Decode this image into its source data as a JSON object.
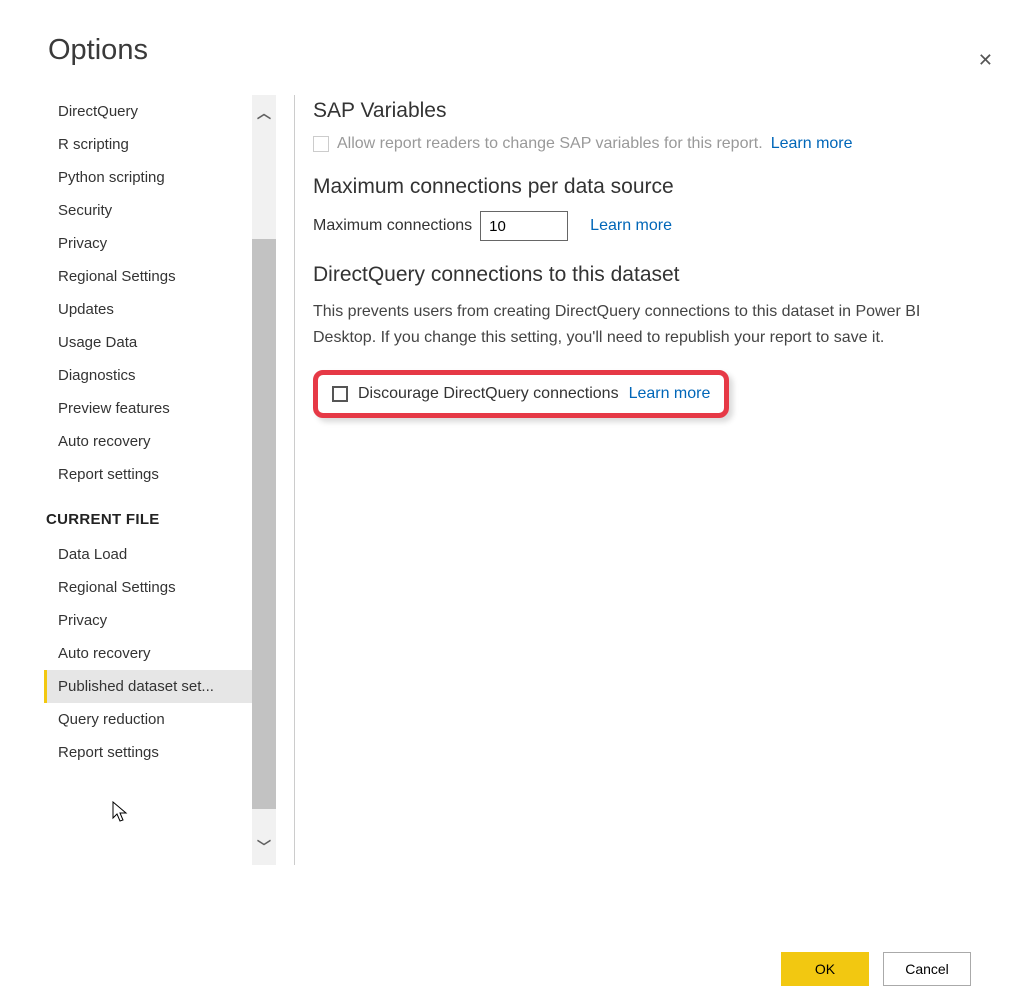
{
  "dialog": {
    "title": "Options",
    "ok_label": "OK",
    "cancel_label": "Cancel"
  },
  "sidebar": {
    "global_items": [
      "DirectQuery",
      "R scripting",
      "Python scripting",
      "Security",
      "Privacy",
      "Regional Settings",
      "Updates",
      "Usage Data",
      "Diagnostics",
      "Preview features",
      "Auto recovery",
      "Report settings"
    ],
    "section_label": "CURRENT FILE",
    "file_items": [
      "Data Load",
      "Regional Settings",
      "Privacy",
      "Auto recovery",
      "Published dataset set...",
      "Query reduction",
      "Report settings"
    ],
    "selected_file_index": 4
  },
  "content": {
    "sap": {
      "heading": "SAP Variables",
      "checkbox_label": "Allow report readers to change SAP variables for this report.",
      "learn_more": "Learn more"
    },
    "maxconn": {
      "heading": "Maximum connections per data source",
      "field_label": "Maximum connections",
      "value": "10",
      "learn_more": "Learn more"
    },
    "dq": {
      "heading": "DirectQuery connections to this dataset",
      "description": "This prevents users from creating DirectQuery connections to this dataset in Power BI Desktop. If you change this setting, you'll need to republish your report to save it.",
      "checkbox_label": "Discourage DirectQuery connections",
      "learn_more": "Learn more"
    }
  }
}
